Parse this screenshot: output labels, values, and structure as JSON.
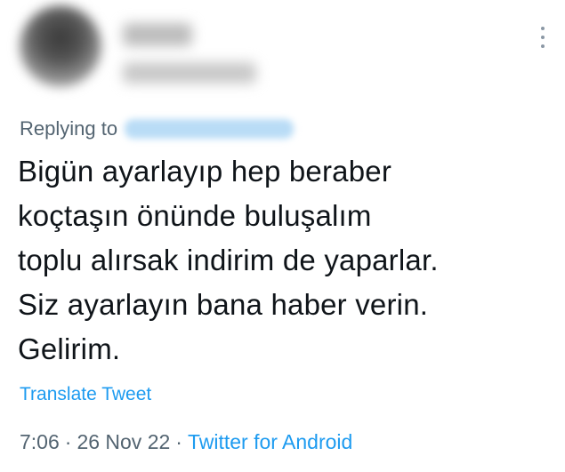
{
  "header": {
    "more_icon": "more-vertical-icon"
  },
  "reply": {
    "prefix": "Replying to"
  },
  "tweet": {
    "text": "Bigün ayarlayıp hep beraber\nkoçtaşın önünde buluşalım\ntoplu alırsak indirim de yaparlar.\nSiz ayarlayın bana haber verin.\nGelirim."
  },
  "translate_label": "Translate Tweet",
  "meta": {
    "time": "7:06",
    "separator": "·",
    "date": "26 Nov 22",
    "source": "Twitter for Android"
  },
  "colors": {
    "link": "#1d9bf0",
    "secondary_text": "#536471",
    "primary_text": "#0f1419"
  }
}
